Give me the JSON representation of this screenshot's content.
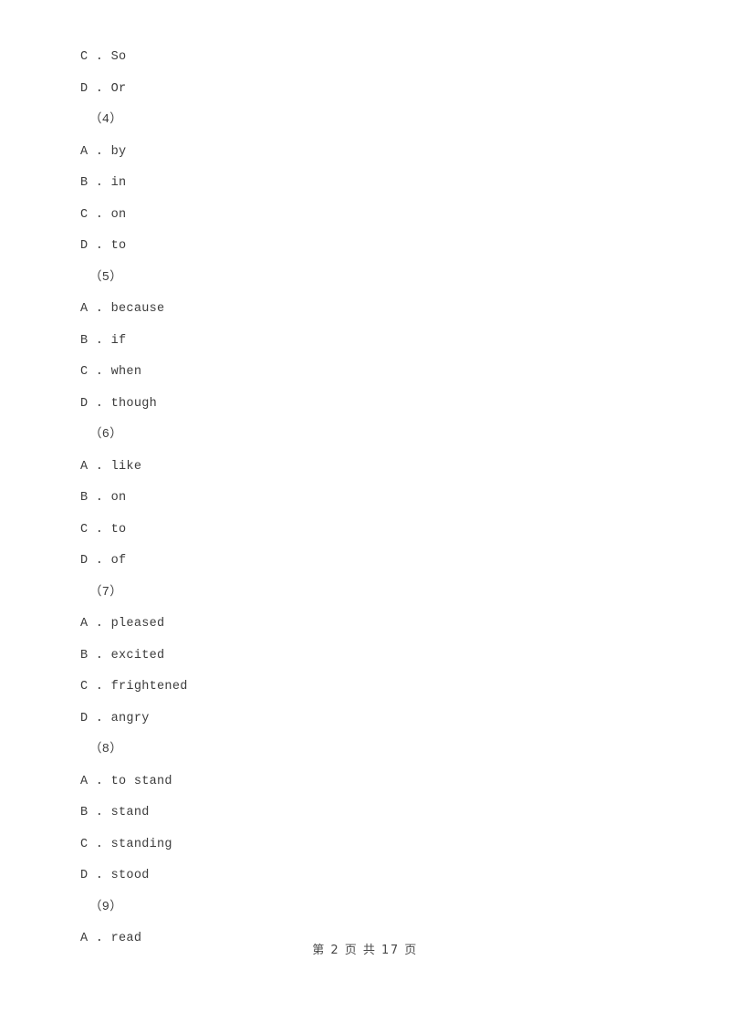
{
  "document": {
    "page_background": "#ffffff",
    "text_color": "#3c3c3c",
    "lines": [
      {
        "kind": "option",
        "letter": "C",
        "separator": " . ",
        "text": "So"
      },
      {
        "kind": "option",
        "letter": "D",
        "separator": " . ",
        "text": "Or"
      },
      {
        "kind": "group",
        "text": "（4）"
      },
      {
        "kind": "option",
        "letter": "A",
        "separator": " . ",
        "text": "by"
      },
      {
        "kind": "option",
        "letter": "B",
        "separator": " . ",
        "text": "in"
      },
      {
        "kind": "option",
        "letter": "C",
        "separator": " . ",
        "text": "on"
      },
      {
        "kind": "option",
        "letter": "D",
        "separator": " . ",
        "text": "to"
      },
      {
        "kind": "group",
        "text": "（5）"
      },
      {
        "kind": "option",
        "letter": "A",
        "separator": " . ",
        "text": "because"
      },
      {
        "kind": "option",
        "letter": "B",
        "separator": " . ",
        "text": "if"
      },
      {
        "kind": "option",
        "letter": "C",
        "separator": " . ",
        "text": "when"
      },
      {
        "kind": "option",
        "letter": "D",
        "separator": " . ",
        "text": "though"
      },
      {
        "kind": "group",
        "text": "（6）"
      },
      {
        "kind": "option",
        "letter": "A",
        "separator": " . ",
        "text": "like"
      },
      {
        "kind": "option",
        "letter": "B",
        "separator": " . ",
        "text": "on"
      },
      {
        "kind": "option",
        "letter": "C",
        "separator": " . ",
        "text": "to"
      },
      {
        "kind": "option",
        "letter": "D",
        "separator": " . ",
        "text": "of"
      },
      {
        "kind": "group",
        "text": "（7）"
      },
      {
        "kind": "option",
        "letter": "A",
        "separator": " . ",
        "text": "pleased"
      },
      {
        "kind": "option",
        "letter": "B",
        "separator": " . ",
        "text": "excited"
      },
      {
        "kind": "option",
        "letter": "C",
        "separator": " . ",
        "text": "frightened"
      },
      {
        "kind": "option",
        "letter": "D",
        "separator": " . ",
        "text": "angry"
      },
      {
        "kind": "group",
        "text": "（8）"
      },
      {
        "kind": "option",
        "letter": "A",
        "separator": " . ",
        "text": "to stand"
      },
      {
        "kind": "option",
        "letter": "B",
        "separator": " . ",
        "text": "stand"
      },
      {
        "kind": "option",
        "letter": "C",
        "separator": " . ",
        "text": "standing"
      },
      {
        "kind": "option",
        "letter": "D",
        "separator": " . ",
        "text": "stood"
      },
      {
        "kind": "group",
        "text": "（9）"
      },
      {
        "kind": "option",
        "letter": "A",
        "separator": " . ",
        "text": "read"
      }
    ]
  },
  "footer": {
    "text": "第 2 页 共 17 页",
    "current_page": "2",
    "total_pages": "17"
  }
}
